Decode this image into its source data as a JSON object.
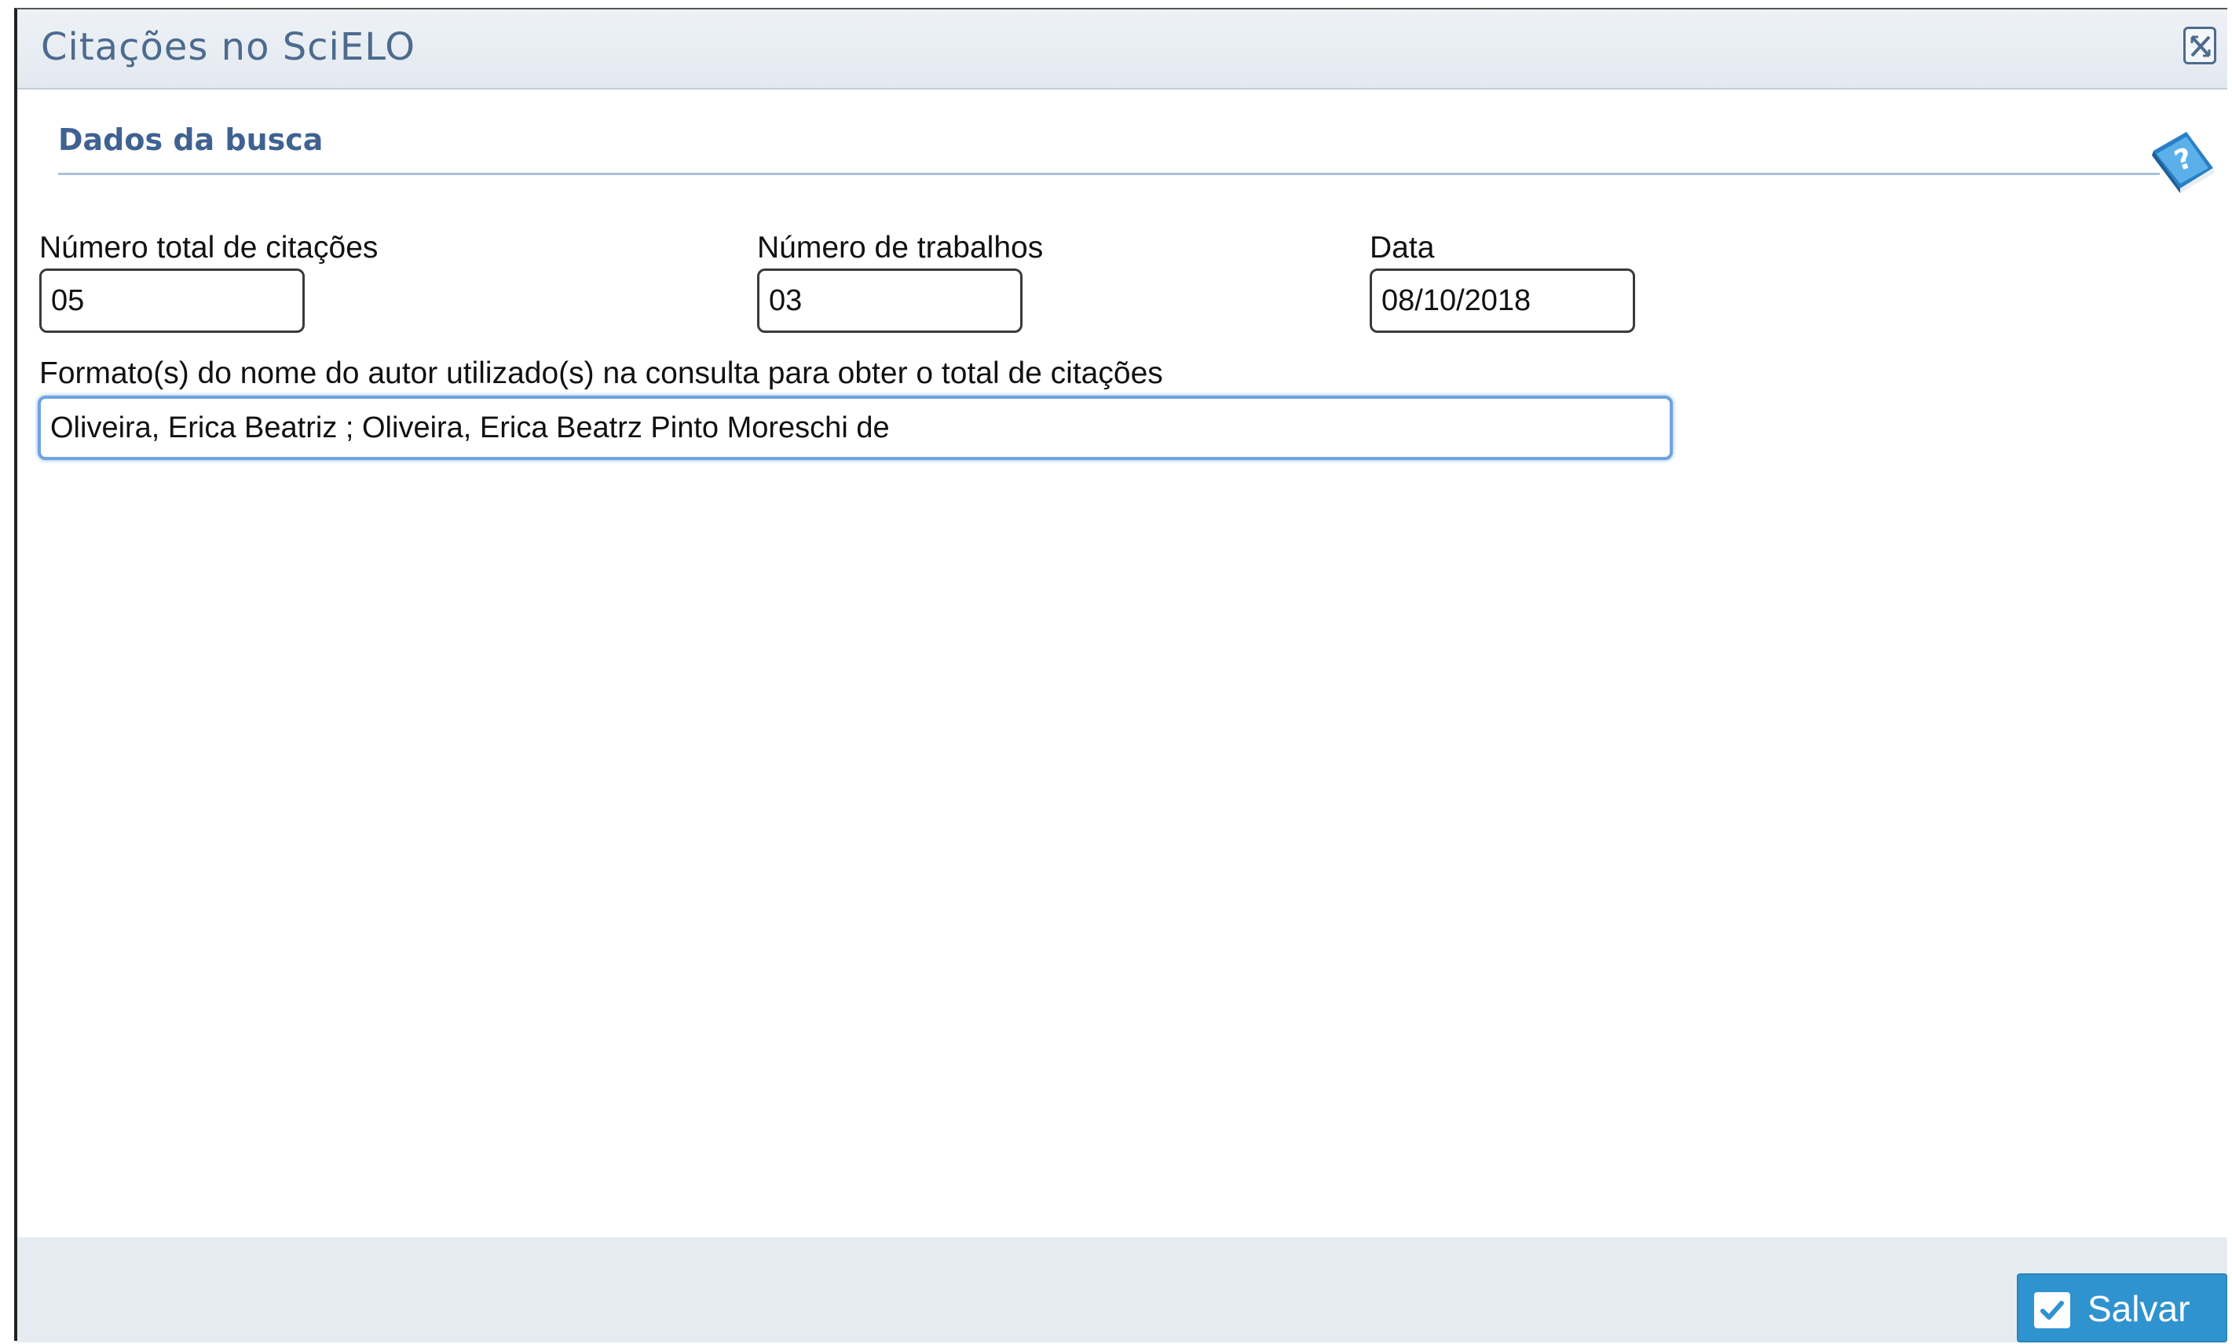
{
  "dialog": {
    "title": "Citações no SciELO"
  },
  "section": {
    "title": "Dados da busca"
  },
  "fields": {
    "total_citacoes": {
      "label": "Número total de citações",
      "value": "05"
    },
    "numero_trabalhos": {
      "label": "Número de trabalhos",
      "value": "03"
    },
    "data": {
      "label": "Data",
      "value": "08/10/2018"
    },
    "formato_nome": {
      "label": "Formato(s) do nome do autor utilizado(s) na consulta para obter o total de citações",
      "value": "Oliveira, Erica Beatriz ; Oliveira, Erica Beatrz Pinto Moreschi de"
    }
  },
  "footer": {
    "save_label": "Salvar"
  },
  "icons": {
    "close": "close-icon",
    "help": "help-book-icon",
    "save": "check-icon"
  },
  "colors": {
    "title_text": "#4d6b8e",
    "section_title": "#3f6291",
    "save_button": "#2f93cf",
    "focus_border": "#6fa3e0"
  }
}
